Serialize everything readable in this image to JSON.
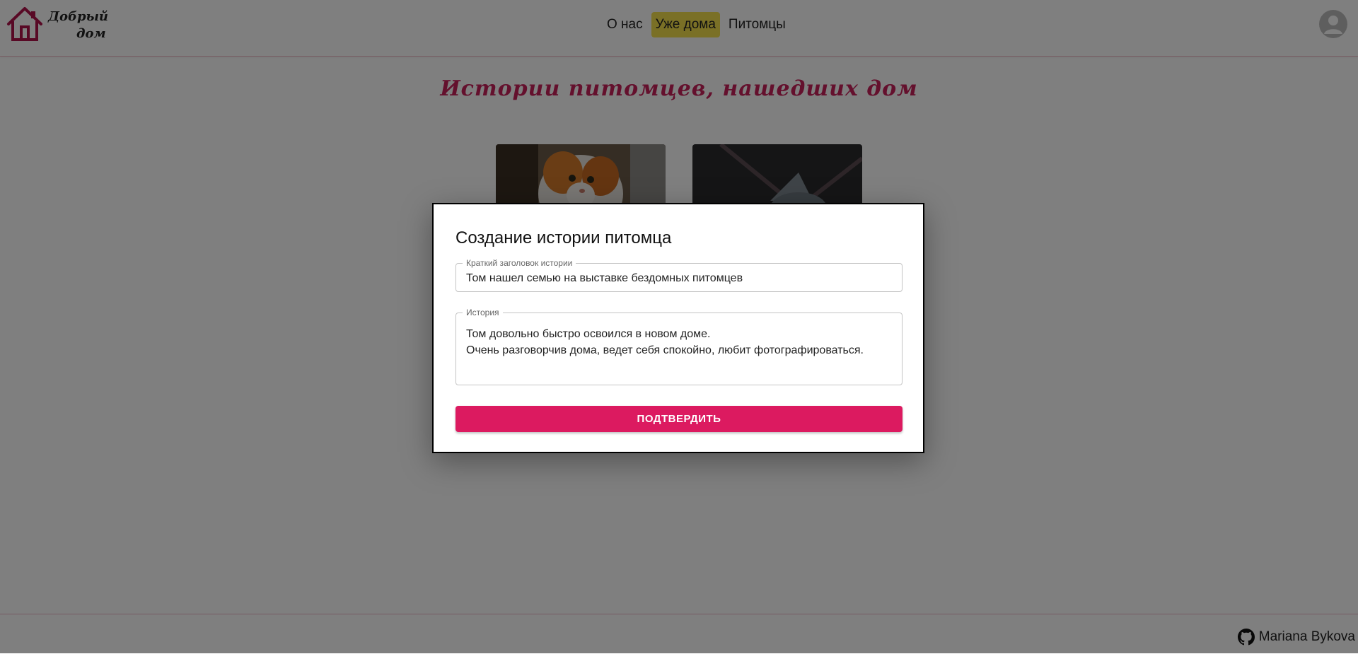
{
  "header": {
    "logo_line1": "Добрый",
    "logo_line2": "дом",
    "nav": [
      {
        "label": "О нас"
      },
      {
        "label": "Уже дома"
      },
      {
        "label": "Питомцы"
      }
    ],
    "active_nav": "Уже дома",
    "avatar_icon": "account-circle-icon"
  },
  "main": {
    "title": "Истории питомцев, нашедших дом"
  },
  "modal": {
    "title": "Создание истории питомца",
    "title_field_label": "Краткий заголовок истории",
    "title_field_value": "Том нашел семью на выставке бездомных питомцев",
    "story_field_label": "История",
    "story_line1": "Том довольно быстро освоился в новом доме.",
    "story_line2": "Очень разговорчив дома, ведет себя спокойно, любит фотографироваться.",
    "confirm_label": "ПОДТВЕРДИТЬ"
  },
  "footer": {
    "author": "Mariana Bykova",
    "icon": "github-icon"
  },
  "colors": {
    "accent": "#dc1a60",
    "active_nav_bg": "#f4e04d",
    "title_color": "#c8205a"
  }
}
